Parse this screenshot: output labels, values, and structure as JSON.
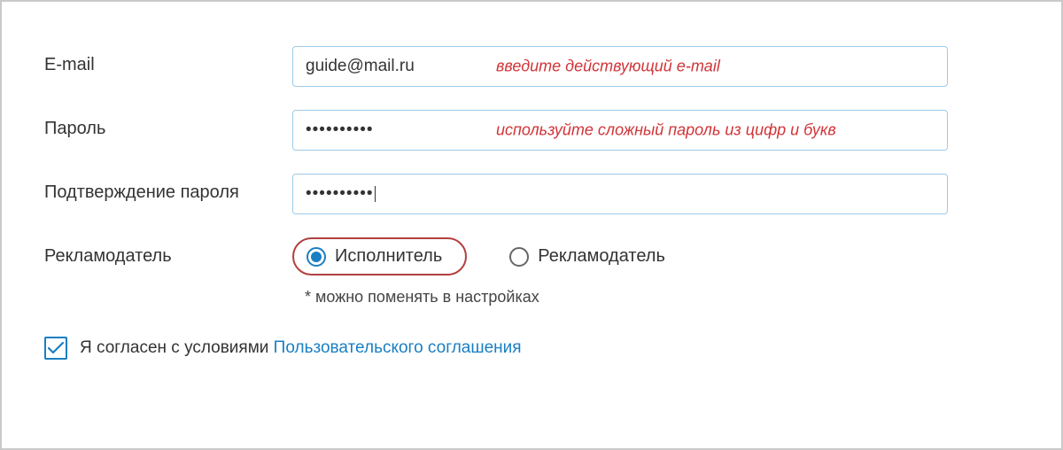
{
  "labels": {
    "email": "E-mail",
    "password": "Пароль",
    "confirm": "Подтверждение пароля",
    "role": "Рекламодатель"
  },
  "fields": {
    "email_value": "guide@mail.ru",
    "email_hint": "введите действующий e-mail",
    "password_value": "••••••••••",
    "password_hint": "используйте сложный пароль из цифр и букв",
    "confirm_value": "••••••••••"
  },
  "role": {
    "option1": "Исполнитель",
    "option2": "Рекламодатель",
    "note": "* можно поменять в настройках"
  },
  "agree": {
    "text": "Я согласен с условиями ",
    "link": "Пользовательского соглашения"
  }
}
